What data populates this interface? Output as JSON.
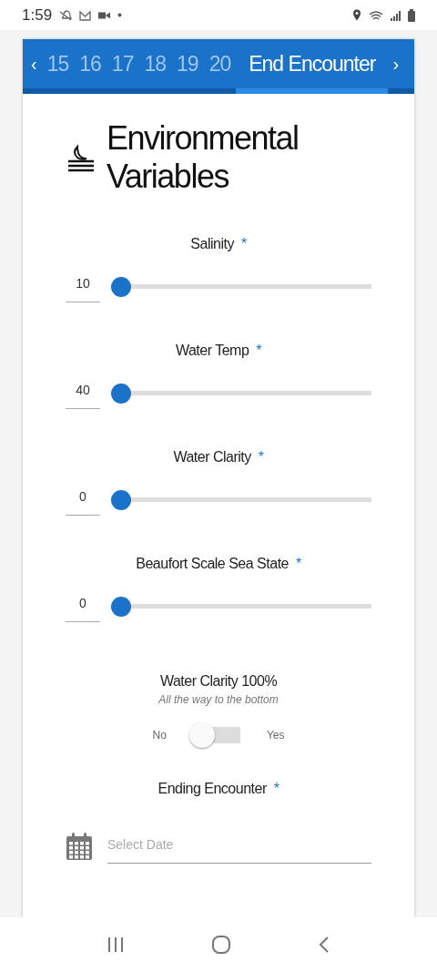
{
  "status_bar": {
    "time": "1:59"
  },
  "tabs": {
    "prev": "‹",
    "next": "›",
    "items": [
      {
        "label": "15",
        "selected": false
      },
      {
        "label": "16",
        "selected": false
      },
      {
        "label": "17",
        "selected": false
      },
      {
        "label": "18",
        "selected": false
      },
      {
        "label": "19",
        "selected": false
      },
      {
        "label": "20",
        "selected": false
      },
      {
        "label": "End Encounter",
        "selected": true
      }
    ]
  },
  "title": "Environmental Variables",
  "required_mark": "*",
  "fields": [
    {
      "kind": "slider",
      "label": "Salinity",
      "required": true,
      "value": "10",
      "level": 0
    },
    {
      "kind": "slider",
      "label": "Water Temp",
      "required": true,
      "value": "40",
      "level": 0
    },
    {
      "kind": "slider",
      "label": "Water Clarity",
      "required": true,
      "value": "0",
      "level": 0
    },
    {
      "kind": "slider",
      "label": "Beaufort Scale Sea State",
      "required": true,
      "value": "0",
      "level": 0
    },
    {
      "kind": "toggle",
      "label": "Water Clarity 100%",
      "hint": "All the way to the bottom",
      "off_label": "No",
      "on_label": "Yes",
      "on": false
    },
    {
      "kind": "date",
      "label": "Ending Encounter",
      "required": true,
      "placeholder": "Select Date"
    }
  ]
}
